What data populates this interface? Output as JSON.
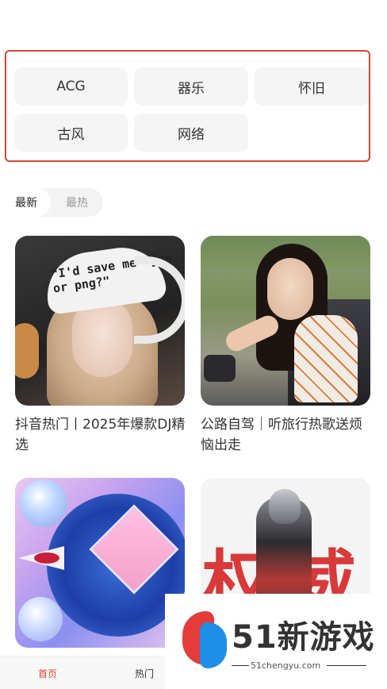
{
  "tags": {
    "row1": [
      "ACG",
      "器乐",
      "怀旧"
    ],
    "row2": [
      "古风",
      "网络"
    ]
  },
  "sort": {
    "active": "最新",
    "inactive": "最热"
  },
  "cards": [
    {
      "title": "抖音热门丨2025年爆款DJ精选",
      "image_text": "\"I'd save me\" jpg or png?\""
    },
    {
      "title": "公路自驾｜听旅行热歌送烦恼出走"
    },
    {
      "title": ""
    },
    {
      "title": ""
    }
  ],
  "watermark": {
    "brand": "51新游戏",
    "url": "51chengyu.com"
  },
  "bottom_nav": {
    "items": [
      "首页",
      "热门"
    ],
    "active": "首页"
  },
  "colors": {
    "accent": "#e0452f",
    "tag_bg": "#f5f5f5"
  }
}
